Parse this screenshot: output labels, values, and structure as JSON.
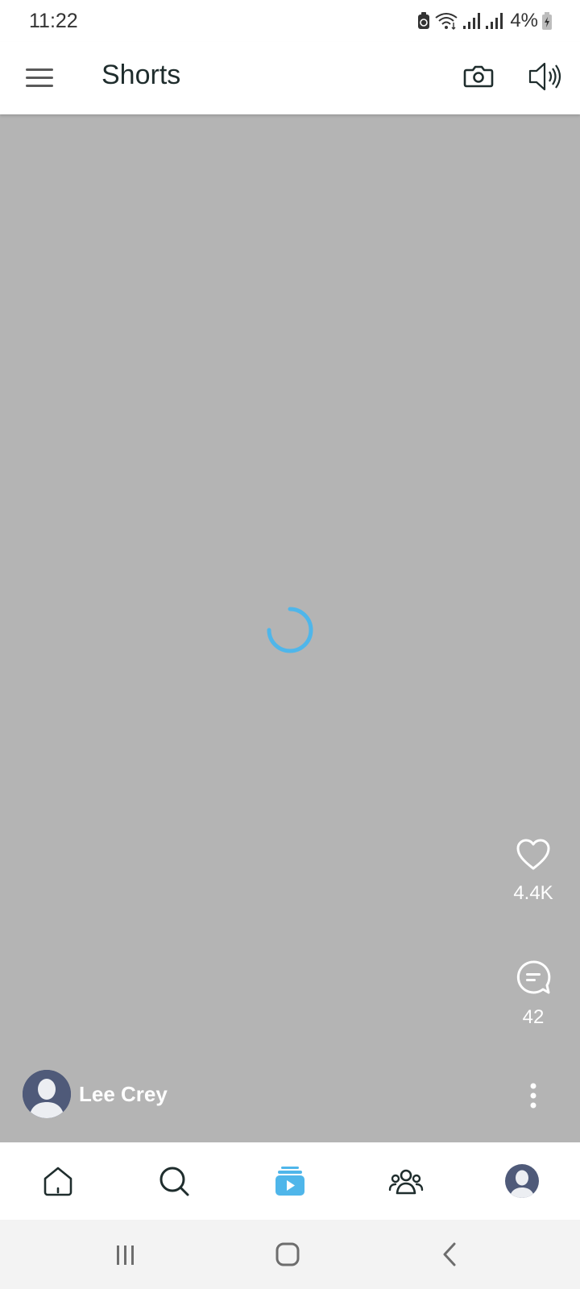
{
  "status_bar": {
    "time": "11:22",
    "battery_text": "4%",
    "icons": [
      "battery-saver-icon",
      "wifi-icon",
      "signal-icon",
      "signal-icon",
      "battery-charging-icon"
    ]
  },
  "app_bar": {
    "title": "Shorts",
    "menu_icon": "hamburger-menu-icon",
    "camera_icon": "camera-icon",
    "sound_icon": "speaker-on-icon"
  },
  "video": {
    "state": "loading",
    "background_color": "#b4b4b4",
    "spinner_color": "#4fb6ea"
  },
  "actions": {
    "like_count": "4.4K",
    "comment_count": "42",
    "like_icon": "heart-icon",
    "comment_icon": "comment-icon",
    "more_icon": "more-vertical-icon"
  },
  "author": {
    "name": "Lee Crey",
    "avatar_color": "#4f5a79"
  },
  "bottom_nav": {
    "items": [
      {
        "name": "home",
        "icon": "home-icon",
        "active": false
      },
      {
        "name": "search",
        "icon": "search-icon",
        "active": false
      },
      {
        "name": "shorts",
        "icon": "shorts-icon",
        "active": true
      },
      {
        "name": "people",
        "icon": "people-icon",
        "active": false
      },
      {
        "name": "profile",
        "icon": "avatar-icon",
        "active": false
      }
    ],
    "active_color": "#4fb6ea",
    "inactive_color": "#1f2d2d"
  },
  "system_nav": {
    "icons": [
      "recents-icon",
      "home-button-icon",
      "back-icon"
    ]
  }
}
